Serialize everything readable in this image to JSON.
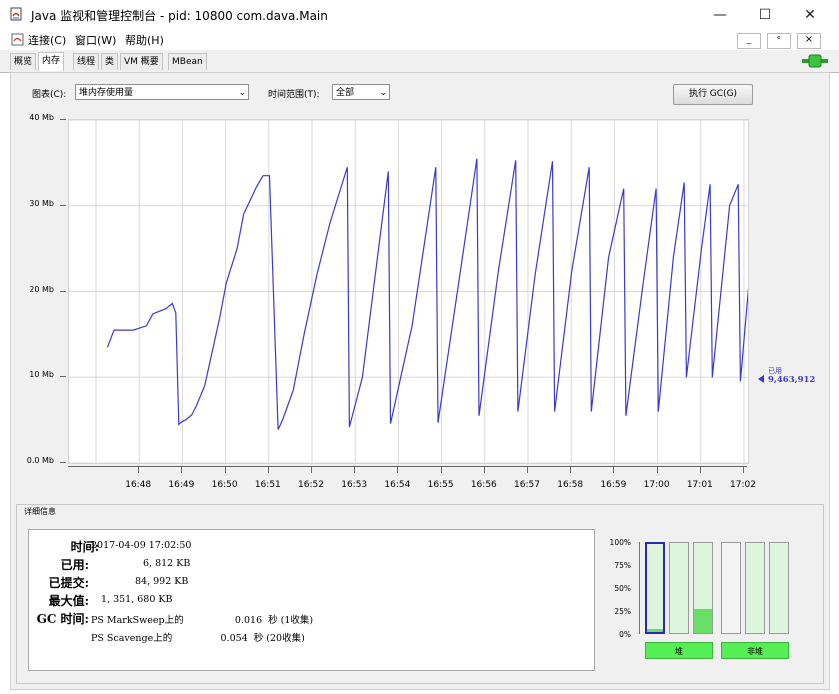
{
  "window": {
    "title": "Java 监视和管理控制台 - pid: 10800 com.dava.Main",
    "minimize": "—",
    "maximize": "☐",
    "close": "✕"
  },
  "menubar": {
    "items": [
      "连接(C)",
      "窗口(W)",
      "帮助(H)"
    ],
    "mdi_buttons": [
      "_",
      "ᵉ",
      "×"
    ]
  },
  "tabs": [
    "概览",
    "内存",
    "线程",
    "类",
    "VM 概要",
    "MBean"
  ],
  "active_tab": "内存",
  "toolbar": {
    "chart_label": "图表(C):",
    "chart_value": "堆内存使用量",
    "range_label": "时间范围(T):",
    "range_value": "全部",
    "gc_button": "执行 GC(G)"
  },
  "chart_data": {
    "type": "line",
    "yticks": [
      "40 Mb",
      "30 Mb",
      "20 Mb",
      "10 Mb",
      "0.0 Mb"
    ],
    "ylim": [
      0,
      40
    ],
    "xticks": [
      "16:48",
      "16:49",
      "16:50",
      "16:51",
      "16:52",
      "16:53",
      "16:54",
      "16:55",
      "16:56",
      "16:57",
      "16:58",
      "16:59",
      "17:00",
      "17:01",
      "17:02"
    ],
    "xlim": [
      0.0,
      15.0
    ],
    "series": [
      {
        "name": "已用",
        "color": "#3a3acc",
        "x": [
          0.0,
          0.15,
          0.4,
          0.6,
          0.9,
          1.05,
          1.35,
          1.5,
          1.58,
          1.65,
          1.72,
          1.8,
          1.95,
          2.05,
          2.25,
          2.6,
          2.75,
          3.0,
          3.15,
          3.45,
          3.6,
          3.75,
          3.95,
          4.05,
          4.3,
          4.55,
          4.85,
          5.15,
          5.55,
          5.6,
          5.9,
          6.5,
          6.55,
          7.05,
          7.6,
          7.65,
          8.1,
          8.55,
          8.6,
          9.05,
          9.45,
          9.5,
          9.9,
          10.3,
          10.35,
          10.75,
          11.15,
          11.2,
          11.6,
          11.95,
          12.0,
          12.4,
          12.7,
          12.75,
          13.1,
          13.35,
          13.4,
          13.75,
          13.95,
          14.0,
          14.4,
          14.6,
          14.65,
          15.0,
          15.1
        ],
        "y": [
          13.5,
          15.5,
          15.5,
          15.5,
          16.0,
          17.4,
          18.0,
          18.6,
          17.5,
          4.5,
          4.8,
          5.0,
          5.6,
          6.6,
          9.0,
          17.0,
          21.0,
          25.0,
          29.0,
          32.2,
          33.5,
          33.5,
          3.9,
          5.0,
          8.5,
          15.0,
          22.0,
          28.0,
          34.5,
          4.2,
          10.0,
          34.0,
          4.6,
          16.0,
          34.5,
          4.7,
          20.0,
          35.5,
          5.5,
          22.5,
          35.3,
          6.0,
          22.0,
          35.2,
          6.0,
          22.5,
          34.5,
          6.0,
          24.0,
          32.0,
          5.5,
          21.0,
          32.0,
          6.0,
          24.0,
          32.7,
          10.0,
          25.0,
          32.5,
          10.0,
          30.0,
          32.5,
          9.5,
          29.8,
          9.5
        ]
      }
    ],
    "annotation": {
      "label": "已用",
      "value": "9,463,912"
    }
  },
  "details": {
    "legend": "详细信息",
    "rows": [
      {
        "label": "时间:",
        "value": "2017-04-09 17:02:50"
      },
      {
        "label": "已用:",
        "value": "6, 812 KB"
      },
      {
        "label": "已提交:",
        "value": "84, 992 KB"
      },
      {
        "label": "最大值:",
        "value": "1, 351, 680 KB"
      },
      {
        "label": "GC 时间:",
        "value": "PS MarkSweep上的                 0.016  秒 (1收集)"
      },
      {
        "label": "",
        "value": "PS Scavenge上的                0.054  秒 (20收集)"
      }
    ]
  },
  "pool_bars": {
    "axis": [
      "100%",
      "75%",
      "50%",
      "25%",
      "0%"
    ],
    "heap_fills": [
      0.03,
      0.0,
      0.27
    ],
    "nonheap_fills": [
      0.0,
      0.0,
      0.0
    ],
    "heap_label": "堆",
    "nonheap_label": "非堆",
    "colors": {
      "fill": "#68e068",
      "empty": "#ddf5dd",
      "selected_border": "#2a2ab0"
    }
  }
}
